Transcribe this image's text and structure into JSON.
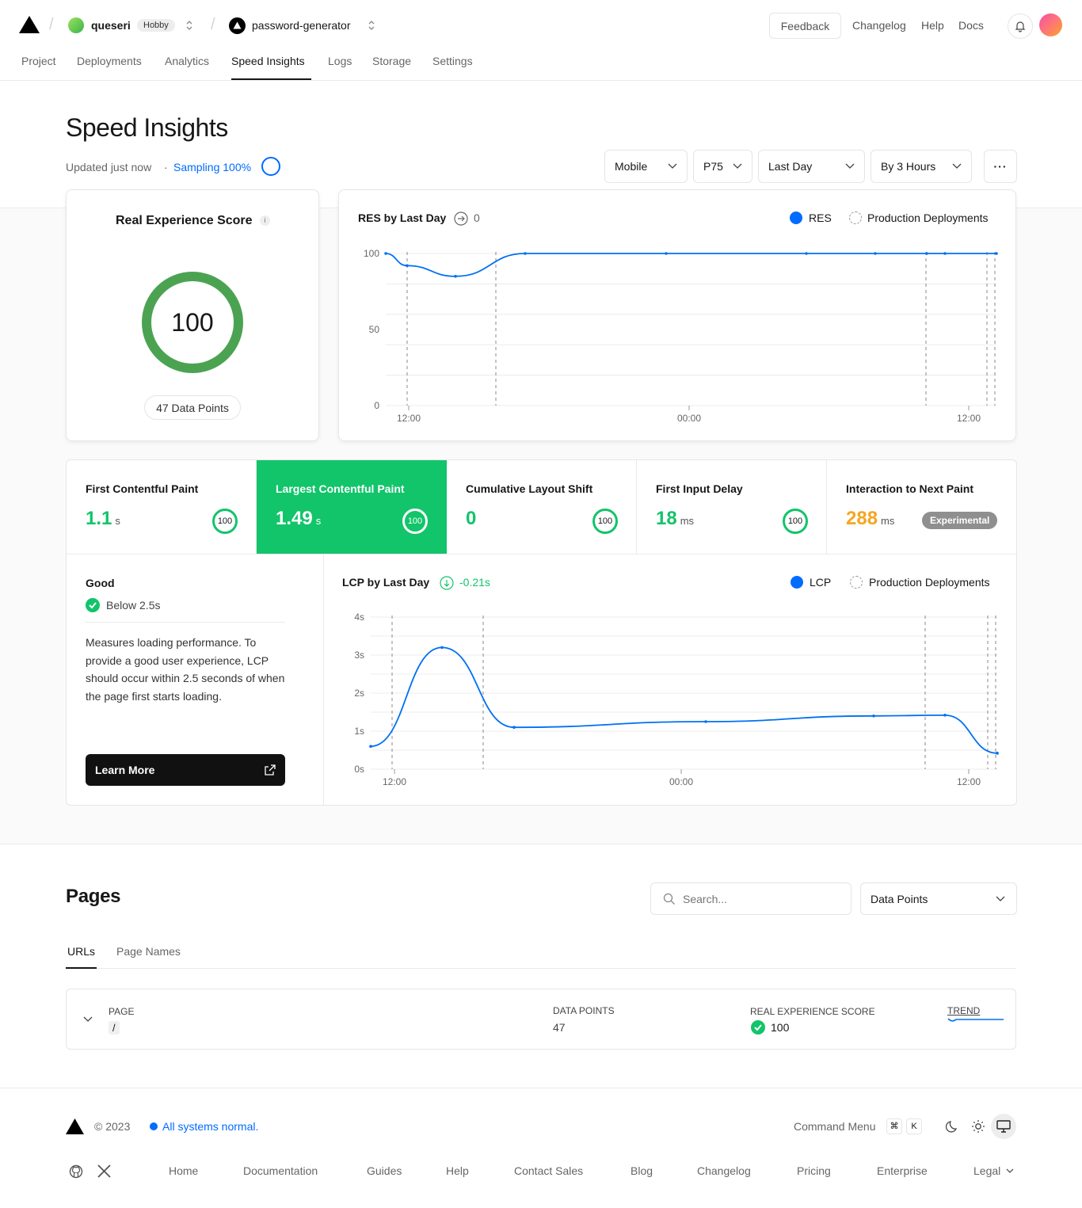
{
  "header": {
    "team": "queseri",
    "plan": "Hobby",
    "project": "password-generator",
    "feedback": "Feedback",
    "links": [
      "Changelog",
      "Help",
      "Docs"
    ]
  },
  "nav": {
    "tabs": [
      "Project",
      "Deployments",
      "Analytics",
      "Speed Insights",
      "Logs",
      "Storage",
      "Settings"
    ],
    "active": "Speed Insights"
  },
  "page": {
    "title": "Speed Insights",
    "updated": "Updated just now",
    "separator": "·",
    "sampling": "Sampling 100%",
    "filters": {
      "device": "Mobile",
      "percentile": "P75",
      "range": "Last Day",
      "granularity": "By 3 Hours",
      "more": "···"
    }
  },
  "res_card": {
    "title": "Real Experience Score",
    "score": "100",
    "data_points": "47 Data Points"
  },
  "res_chart": {
    "title": "RES by Last Day",
    "delta": "0",
    "legend_primary": "RES",
    "legend_secondary": "Production Deployments"
  },
  "metrics": [
    {
      "name": "First Contentful Paint",
      "value": "1.1",
      "unit": "s",
      "score": "100"
    },
    {
      "name": "Largest Contentful Paint",
      "value": "1.49",
      "unit": "s",
      "score": "100"
    },
    {
      "name": "Cumulative Layout Shift",
      "value": "0",
      "unit": "",
      "score": "100"
    },
    {
      "name": "First Input Delay",
      "value": "18",
      "unit": "ms",
      "score": "100"
    },
    {
      "name": "Interaction to Next Paint",
      "value": "288",
      "unit": "ms",
      "badge": "Experimental"
    }
  ],
  "lcp_detail": {
    "rating": "Good",
    "threshold": "Below 2.5s",
    "description": "Measures loading performance. To provide a good user experience, LCP should occur within 2.5 seconds of when the page first starts loading.",
    "learn_more": "Learn More"
  },
  "lcp_chart": {
    "title": "LCP by Last Day",
    "delta": "-0.21s",
    "legend_primary": "LCP",
    "legend_secondary": "Production Deployments"
  },
  "pages": {
    "title": "Pages",
    "search_placeholder": "Search...",
    "sort": "Data Points",
    "tabs": [
      "URLs",
      "Page Names"
    ],
    "columns": {
      "page": "PAGE",
      "data_points": "DATA POINTS",
      "score": "REAL EXPERIENCE SCORE",
      "trend": "TREND"
    },
    "rows": [
      {
        "page": "/",
        "data_points": "47",
        "score": "100"
      }
    ]
  },
  "footer": {
    "copyright": "© 2023",
    "status": "All systems normal.",
    "command_menu": "Command Menu",
    "kbd": [
      "⌘",
      "K"
    ],
    "links": [
      "Home",
      "Documentation",
      "Guides",
      "Help",
      "Contact Sales",
      "Blog",
      "Changelog",
      "Pricing",
      "Enterprise",
      "Legal"
    ]
  },
  "colors": {
    "accent": "#006bff",
    "good": "#12c46a",
    "ring": "#4ba352",
    "warn": "#f5a623",
    "line": "#0070f3"
  },
  "chart_data": [
    {
      "type": "line",
      "title": "RES by Last Day",
      "series": [
        {
          "name": "RES",
          "values": [
            100,
            92,
            85,
            100,
            100,
            100,
            100,
            100,
            100,
            100
          ]
        }
      ],
      "x_ticks": [
        "12:00",
        "00:00",
        "12:00"
      ],
      "ylim": [
        0,
        100
      ],
      "y_ticks": [
        "100",
        "50",
        "0"
      ]
    },
    {
      "type": "line",
      "title": "LCP by Last Day",
      "series": [
        {
          "name": "LCP",
          "values": [
            0.6,
            3.2,
            1.1,
            1.25,
            1.4,
            1.42,
            0.42,
            0.42
          ]
        }
      ],
      "x_ticks": [
        "12:00",
        "00:00",
        "12:00"
      ],
      "ylim": [
        0,
        4
      ],
      "y_ticks": [
        "4s",
        "3s",
        "2s",
        "1s",
        "0s"
      ]
    }
  ]
}
